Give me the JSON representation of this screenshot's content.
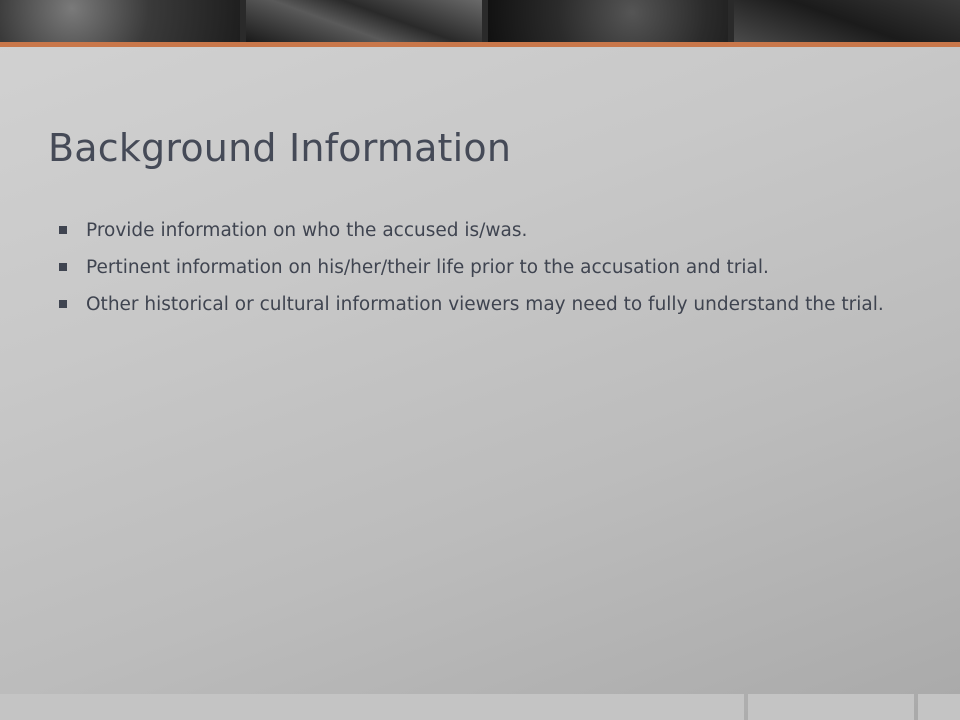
{
  "slide": {
    "title": "Background Information",
    "bullets": [
      "Provide information on who the accused is/was.",
      "Pertinent information on his/her/their life prior to the accusation and trial.",
      "Other historical or cultural information viewers may need to fully understand the trial."
    ]
  },
  "colors": {
    "accent": "#c9774a",
    "text": "#3f4450",
    "title": "#454a57"
  }
}
